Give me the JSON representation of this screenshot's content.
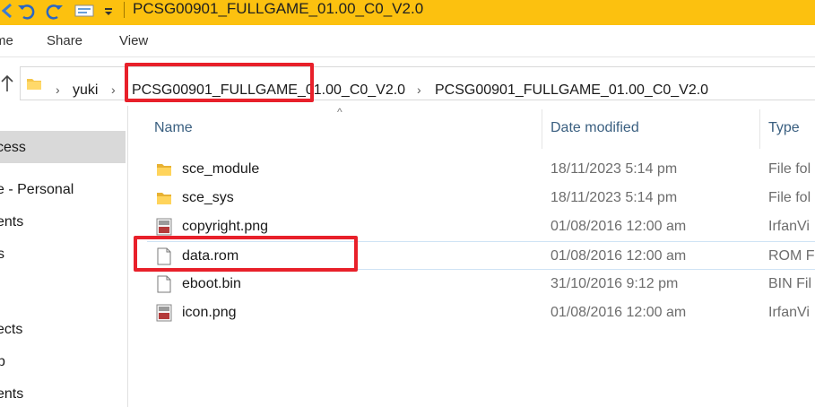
{
  "window": {
    "title": "PCSG00901_FULLGAME_01.00_C0_V2.0"
  },
  "ribbon": {
    "tabs": [
      "me",
      "Share",
      "View"
    ]
  },
  "address": {
    "crumbs": [
      "yuki",
      "PCSG00901_FULLGAME_01.00_C0_V2.0",
      "PCSG00901_FULLGAME_01.00_C0_V2.0"
    ]
  },
  "nav": {
    "items": [
      "cess",
      "e - Personal",
      "ents",
      "s",
      "ects",
      "p",
      "ents"
    ]
  },
  "columns": {
    "name": "Name",
    "date": "Date modified",
    "type": "Type"
  },
  "files": [
    {
      "name": "sce_module",
      "date": "18/11/2023 5:14 pm",
      "type": "File fol",
      "icon": "folder-icon"
    },
    {
      "name": "sce_sys",
      "date": "18/11/2023 5:14 pm",
      "type": "File fol",
      "icon": "folder-icon"
    },
    {
      "name": "copyright.png",
      "date": "01/08/2016 12:00 am",
      "type": "IrfanVi",
      "icon": "image-file-icon"
    },
    {
      "name": "data.rom",
      "date": "01/08/2016 12:00 am",
      "type": "ROM F",
      "icon": "file-icon"
    },
    {
      "name": "eboot.bin",
      "date": "31/10/2016 9:12 pm",
      "type": "BIN Fil",
      "icon": "file-icon"
    },
    {
      "name": "icon.png",
      "date": "01/08/2016 12:00 am",
      "type": "IrfanVi",
      "icon": "image-file-icon"
    }
  ],
  "colors": {
    "titlebar": "#fcc10f",
    "highlight": "#e8202a",
    "header_text": "#3a5f80"
  }
}
